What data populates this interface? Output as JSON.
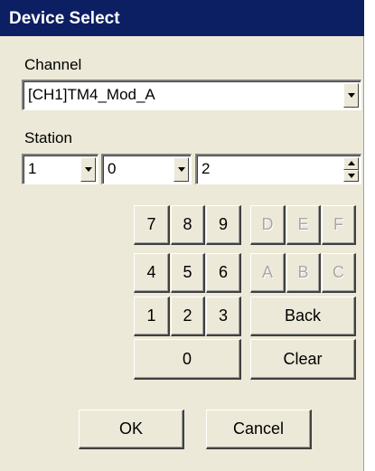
{
  "window": {
    "title": "Device Select"
  },
  "channel": {
    "label": "Channel",
    "value": "[CH1]TM4_Mod_A"
  },
  "station": {
    "label": "Station",
    "combo1_value": "1",
    "combo2_value": "0",
    "spin_value": "2"
  },
  "keypad": {
    "k7": "7",
    "k8": "8",
    "k9": "9",
    "k4": "4",
    "k5": "5",
    "k6": "6",
    "k1": "1",
    "k2": "2",
    "k3": "3",
    "k0": "0",
    "kD": "D",
    "kE": "E",
    "kF": "F",
    "kA": "A",
    "kB": "B",
    "kC": "C",
    "back": "Back",
    "clear": "Clear"
  },
  "footer": {
    "ok": "OK",
    "cancel": "Cancel"
  }
}
